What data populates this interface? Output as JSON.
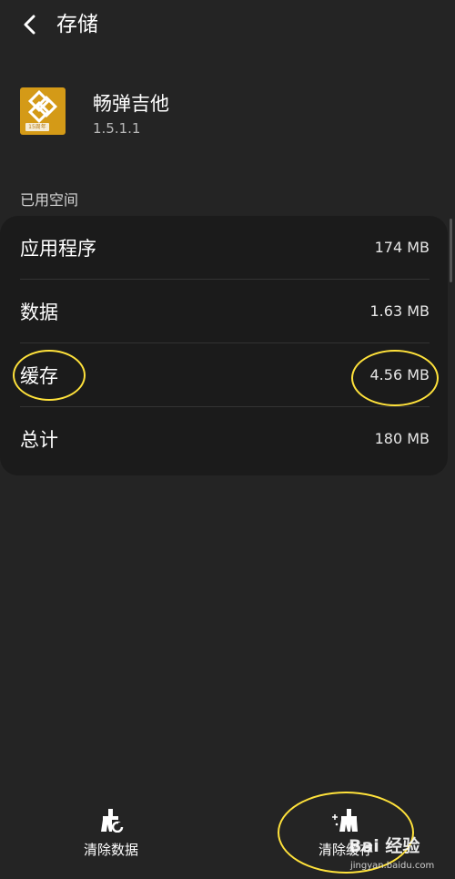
{
  "header": {
    "title": "存储"
  },
  "app": {
    "name": "畅弹吉他",
    "version": "1.5.1.1",
    "icon_badge": "15周年"
  },
  "storage": {
    "section_label": "已用空间",
    "rows": [
      {
        "label": "应用程序",
        "value": "174 MB"
      },
      {
        "label": "数据",
        "value": "1.63 MB"
      },
      {
        "label": "缓存",
        "value": "4.56 MB"
      },
      {
        "label": "总计",
        "value": "180 MB"
      }
    ]
  },
  "bottom_bar": {
    "clear_data_label": "清除数据",
    "clear_cache_label": "清除缓存"
  },
  "watermark": {
    "brand": "Bai 经验",
    "url": "jingyan.baidu.com"
  },
  "colors": {
    "background": "#242424",
    "card": "#1b1b1b",
    "annotation": "#ffe23b",
    "app_icon": "#d49a17"
  }
}
